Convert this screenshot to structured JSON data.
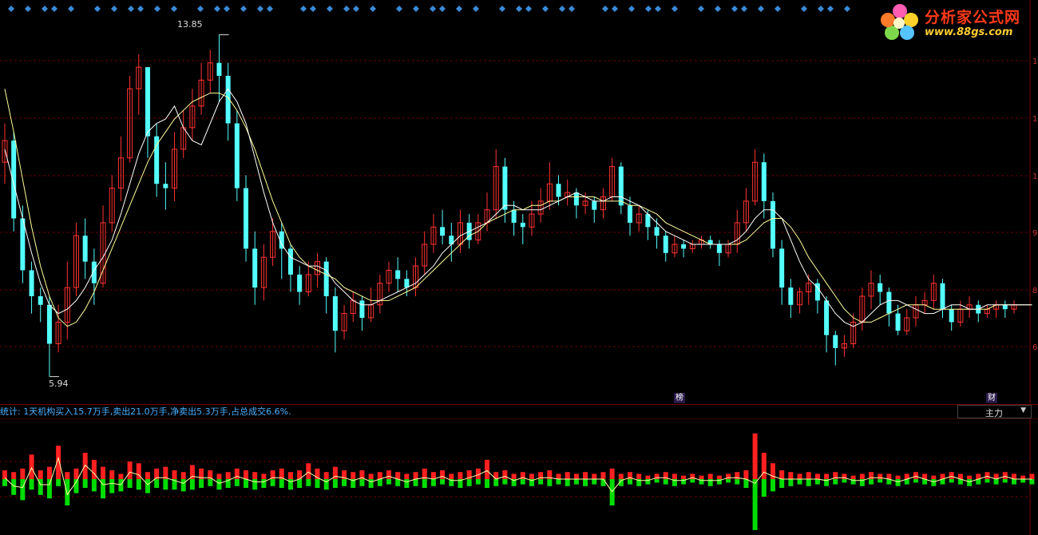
{
  "logo": {
    "title": "分析家公式网",
    "url": "www.88gs.com"
  },
  "stats_text": "统计: 1天机构买入15.7万手,卖出21.0万手,净卖出5.3万手,占总成交6.6%.",
  "dropdown": {
    "selected": "主力",
    "arrow": "▼"
  },
  "badges": {
    "bang": "榜",
    "cai": "财"
  },
  "right_axis_labels": [
    "1",
    "1",
    "1",
    "9",
    "8",
    "6"
  ],
  "colors": {
    "up": "#ff3232",
    "down": "#54ffff",
    "ma_short": "#ffffff",
    "ma_long": "#ffff99",
    "sub_up": "#ff2020",
    "sub_down": "#00dd00",
    "diamond": "#3a8ad8",
    "grid": "#6a0000"
  },
  "chart_data": [
    {
      "type": "candlestick",
      "annotations": {
        "high": "13.85",
        "low": "5.94"
      },
      "candles": [
        [
          10.9,
          11.4,
          11.8,
          10.4
        ],
        [
          11.4,
          9.6,
          11.6,
          9.3
        ],
        [
          9.6,
          8.4,
          9.9,
          8.1
        ],
        [
          8.4,
          7.8,
          8.6,
          7.4
        ],
        [
          7.8,
          7.6,
          8.0,
          7.2
        ],
        [
          7.6,
          6.7,
          7.8,
          5.94
        ],
        [
          6.7,
          7.2,
          7.6,
          6.5
        ],
        [
          7.2,
          8.0,
          8.6,
          6.8
        ],
        [
          8.0,
          9.2,
          9.5,
          7.8
        ],
        [
          9.2,
          8.6,
          9.6,
          8.2
        ],
        [
          8.6,
          8.1,
          8.9,
          7.6
        ],
        [
          8.1,
          9.5,
          9.9,
          8.0
        ],
        [
          9.5,
          10.3,
          10.6,
          9.3
        ],
        [
          10.3,
          11.0,
          11.5,
          10.0
        ],
        [
          11.0,
          12.6,
          12.9,
          10.9
        ],
        [
          12.6,
          13.1,
          13.4,
          12.0
        ],
        [
          13.1,
          11.5,
          12.4,
          11.0
        ],
        [
          11.5,
          10.4,
          11.8,
          10.1
        ],
        [
          10.4,
          10.3,
          10.9,
          9.8
        ],
        [
          10.3,
          11.2,
          11.6,
          10.0
        ],
        [
          11.2,
          11.7,
          12.1,
          11.0
        ],
        [
          11.7,
          12.2,
          12.6,
          11.4
        ],
        [
          12.2,
          12.8,
          13.2,
          12.0
        ],
        [
          12.8,
          13.2,
          13.5,
          12.5
        ],
        [
          13.2,
          12.9,
          13.85,
          12.3
        ],
        [
          12.9,
          11.8,
          13.2,
          11.4
        ],
        [
          11.8,
          10.3,
          12.1,
          10.0
        ],
        [
          10.3,
          8.9,
          10.6,
          8.6
        ],
        [
          8.9,
          8.0,
          9.3,
          7.6
        ],
        [
          8.0,
          8.7,
          9.0,
          7.7
        ],
        [
          8.7,
          9.3,
          9.6,
          8.5
        ],
        [
          9.3,
          8.9,
          9.5,
          8.2
        ],
        [
          8.9,
          8.3,
          9.0,
          7.9
        ],
        [
          8.3,
          7.9,
          8.5,
          7.6
        ],
        [
          7.9,
          8.3,
          8.6,
          7.8
        ],
        [
          8.3,
          8.6,
          8.8,
          8.0
        ],
        [
          8.6,
          7.8,
          8.7,
          7.4
        ],
        [
          7.8,
          7.0,
          8.0,
          6.5
        ],
        [
          7.0,
          7.4,
          7.6,
          6.8
        ],
        [
          7.4,
          7.7,
          7.9,
          7.2
        ],
        [
          7.7,
          7.3,
          7.8,
          7.0
        ],
        [
          7.3,
          7.6,
          8.0,
          7.2
        ],
        [
          7.6,
          8.1,
          8.3,
          7.4
        ],
        [
          8.1,
          8.4,
          8.6,
          7.9
        ],
        [
          8.4,
          8.2,
          8.7,
          7.9
        ],
        [
          8.2,
          8.0,
          8.4,
          7.8
        ],
        [
          8.0,
          8.5,
          8.7,
          7.8
        ],
        [
          8.5,
          9.0,
          9.3,
          8.3
        ],
        [
          9.0,
          9.4,
          9.7,
          8.8
        ],
        [
          9.4,
          9.2,
          9.8,
          9.0
        ],
        [
          9.2,
          9.0,
          9.5,
          8.6
        ],
        [
          9.0,
          9.5,
          9.8,
          8.8
        ],
        [
          9.5,
          9.1,
          9.7,
          8.9
        ],
        [
          9.1,
          9.5,
          9.7,
          9.0
        ],
        [
          9.5,
          9.8,
          10.2,
          9.3
        ],
        [
          9.8,
          10.8,
          11.2,
          9.6
        ],
        [
          10.8,
          9.8,
          11.0,
          9.5
        ],
        [
          9.8,
          9.5,
          10.0,
          9.2
        ],
        [
          9.5,
          9.4,
          9.7,
          9.0
        ],
        [
          9.4,
          9.7,
          10.0,
          9.2
        ],
        [
          9.7,
          10.0,
          10.3,
          9.5
        ],
        [
          10.0,
          10.4,
          10.9,
          9.8
        ],
        [
          10.4,
          10.1,
          10.6,
          9.9
        ],
        [
          10.1,
          10.2,
          10.5,
          9.9
        ],
        [
          10.2,
          9.9,
          10.3,
          9.6
        ],
        [
          9.9,
          10.0,
          10.2,
          9.7
        ],
        [
          10.0,
          9.8,
          10.1,
          9.5
        ],
        [
          9.8,
          10.1,
          10.3,
          9.6
        ],
        [
          10.1,
          10.8,
          11.0,
          10.0
        ],
        [
          10.8,
          9.9,
          10.9,
          9.7
        ],
        [
          9.9,
          9.5,
          10.1,
          9.2
        ],
        [
          9.5,
          9.7,
          9.9,
          9.3
        ],
        [
          9.7,
          9.4,
          9.8,
          9.1
        ],
        [
          9.4,
          9.2,
          9.6,
          8.9
        ],
        [
          9.2,
          8.8,
          9.3,
          8.6
        ],
        [
          8.8,
          9.0,
          9.2,
          8.7
        ],
        [
          9.0,
          8.9,
          9.1,
          8.7
        ],
        [
          8.9,
          9.0,
          9.1,
          8.8
        ],
        [
          9.0,
          9.1,
          9.2,
          8.9
        ],
        [
          9.1,
          9.0,
          9.2,
          8.9
        ],
        [
          9.0,
          8.8,
          9.1,
          8.5
        ],
        [
          8.8,
          9.0,
          9.1,
          8.7
        ],
        [
          9.0,
          9.5,
          9.8,
          8.8
        ],
        [
          9.5,
          10.0,
          10.3,
          9.3
        ],
        [
          10.0,
          10.9,
          11.2,
          9.9
        ],
        [
          10.9,
          10.0,
          11.1,
          9.6
        ],
        [
          10.0,
          8.9,
          10.2,
          8.7
        ],
        [
          8.9,
          8.0,
          9.1,
          7.6
        ],
        [
          8.0,
          7.6,
          8.2,
          7.3
        ],
        [
          7.6,
          7.9,
          8.0,
          7.4
        ],
        [
          7.9,
          8.1,
          8.3,
          7.6
        ],
        [
          8.1,
          7.7,
          8.2,
          7.4
        ],
        [
          7.7,
          6.9,
          7.8,
          6.5
        ],
        [
          6.9,
          6.6,
          7.0,
          6.2
        ],
        [
          6.6,
          6.7,
          6.9,
          6.4
        ],
        [
          6.7,
          7.2,
          7.4,
          6.6
        ],
        [
          7.2,
          7.8,
          8.0,
          7.0
        ],
        [
          7.8,
          8.1,
          8.4,
          7.5
        ],
        [
          8.1,
          7.9,
          8.3,
          7.6
        ],
        [
          7.9,
          7.4,
          8.0,
          7.1
        ],
        [
          7.4,
          7.0,
          7.6,
          6.9
        ],
        [
          7.0,
          7.3,
          7.5,
          6.9
        ],
        [
          7.3,
          7.6,
          7.8,
          7.1
        ],
        [
          7.6,
          7.7,
          7.9,
          7.4
        ],
        [
          7.7,
          8.1,
          8.3,
          7.5
        ],
        [
          8.1,
          7.5,
          8.2,
          7.3
        ],
        [
          7.5,
          7.2,
          7.6,
          7.0
        ],
        [
          7.2,
          7.5,
          7.7,
          7.1
        ],
        [
          7.5,
          7.6,
          7.8,
          7.3
        ],
        [
          7.6,
          7.4,
          7.7,
          7.2
        ],
        [
          7.4,
          7.5,
          7.6,
          7.3
        ],
        [
          7.5,
          7.6,
          7.7,
          7.3
        ],
        [
          7.6,
          7.5,
          7.7,
          7.3
        ],
        [
          7.5,
          7.6,
          7.7,
          7.4
        ]
      ],
      "ma_short": [
        11.2,
        10.4,
        9.6,
        8.8,
        8.1,
        7.6,
        7.4,
        7.5,
        7.7,
        8.0,
        8.4,
        8.7,
        9.1,
        9.7,
        10.4,
        11.1,
        11.6,
        11.8,
        11.9,
        12.2,
        11.7,
        11.4,
        11.3,
        11.8,
        12.3,
        12.6,
        12.3,
        11.8,
        11.0,
        10.2,
        9.5,
        9.0,
        8.7,
        8.6,
        8.5,
        8.5,
        8.4,
        8.1,
        7.9,
        7.7,
        7.6,
        7.6,
        7.7,
        7.8,
        7.9,
        8.0,
        8.1,
        8.3,
        8.5,
        8.8,
        9.0,
        9.2,
        9.3,
        9.4,
        9.5,
        9.7,
        9.9,
        9.9,
        9.8,
        9.8,
        9.8,
        9.9,
        10.0,
        10.1,
        10.2,
        10.1,
        10.0,
        10.0,
        10.1,
        10.1,
        10.0,
        9.9,
        9.7,
        9.5,
        9.3,
        9.2,
        9.1,
        9.0,
        9.0,
        9.0,
        9.0,
        9.0,
        9.1,
        9.3,
        9.6,
        9.8,
        9.8,
        9.6,
        9.1,
        8.6,
        8.2,
        8.0,
        7.7,
        7.4,
        7.2,
        7.1,
        7.2,
        7.4,
        7.6,
        7.7,
        7.7,
        7.6,
        7.5,
        7.4,
        7.4,
        7.5,
        7.6,
        7.6,
        7.5,
        7.5,
        7.6,
        7.6,
        7.6,
        7.6,
        7.6,
        7.6
      ],
      "ma_long": [
        12.6,
        11.6,
        10.5,
        9.4,
        8.5,
        7.8,
        7.3,
        7.1,
        7.2,
        7.5,
        7.9,
        8.4,
        8.9,
        9.4,
        9.9,
        10.4,
        10.9,
        11.3,
        11.6,
        11.9,
        12.1,
        12.3,
        12.4,
        12.5,
        12.5,
        12.4,
        12.1,
        11.7,
        11.2,
        10.6,
        10.0,
        9.5,
        9.0,
        8.7,
        8.5,
        8.4,
        8.3,
        8.2,
        8.0,
        7.9,
        7.8,
        7.7,
        7.7,
        7.7,
        7.8,
        7.9,
        8.0,
        8.2,
        8.4,
        8.6,
        8.8,
        9.0,
        9.2,
        9.3,
        9.5,
        9.6,
        9.7,
        9.8,
        9.8,
        9.9,
        9.9,
        10.0,
        10.0,
        10.1,
        10.1,
        10.1,
        10.1,
        10.0,
        10.0,
        10.0,
        9.9,
        9.9,
        9.8,
        9.7,
        9.5,
        9.4,
        9.3,
        9.2,
        9.1,
        9.0,
        9.0,
        9.0,
        9.0,
        9.1,
        9.3,
        9.5,
        9.6,
        9.6,
        9.4,
        9.1,
        8.7,
        8.4,
        8.1,
        7.8,
        7.5,
        7.3,
        7.2,
        7.2,
        7.3,
        7.4,
        7.5,
        7.6,
        7.6,
        7.6,
        7.5,
        7.5,
        7.5,
        7.5,
        7.5,
        7.5,
        7.5,
        7.6,
        7.6,
        7.6,
        7.6,
        7.6
      ]
    },
    {
      "type": "bar",
      "buy": [
        0.5,
        0.4,
        0.6,
        1.4,
        0.5,
        0.7,
        1.9,
        0.4,
        0.6,
        1.5,
        1.1,
        0.7,
        0.5,
        0.3,
        1.0,
        0.9,
        0.4,
        0.6,
        0.7,
        0.5,
        0.4,
        0.8,
        0.6,
        0.5,
        0.3,
        0.4,
        0.6,
        0.5,
        0.4,
        0.3,
        0.5,
        0.6,
        0.4,
        0.5,
        0.9,
        0.6,
        0.4,
        0.7,
        0.5,
        0.4,
        0.5,
        0.3,
        0.4,
        0.5,
        0.4,
        0.3,
        0.4,
        0.6,
        0.4,
        0.5,
        0.3,
        0.4,
        0.5,
        0.6,
        1.1,
        0.4,
        0.5,
        0.3,
        0.4,
        0.3,
        0.4,
        0.5,
        0.3,
        0.4,
        0.3,
        0.4,
        0.3,
        0.4,
        0.6,
        0.3,
        0.4,
        0.3,
        0.2,
        0.3,
        0.4,
        0.3,
        0.2,
        0.3,
        0.2,
        0.3,
        0.2,
        0.3,
        0.4,
        0.5,
        2.6,
        1.5,
        0.9,
        0.5,
        0.4,
        0.3,
        0.4,
        0.3,
        0.3,
        0.4,
        0.3,
        0.2,
        0.3,
        0.4,
        0.3,
        0.3,
        0.2,
        0.3,
        0.4,
        0.3,
        0.2,
        0.3,
        0.4,
        0.3,
        0.2,
        0.3,
        0.4,
        0.3,
        0.4,
        0.3,
        0.2,
        0.3
      ],
      "sell": [
        0.4,
        0.9,
        1.2,
        0.6,
        0.9,
        1.1,
        0.4,
        1.5,
        0.8,
        0.5,
        0.7,
        1.1,
        0.8,
        0.7,
        0.5,
        0.6,
        0.8,
        0.5,
        0.6,
        0.6,
        0.7,
        0.6,
        0.5,
        0.4,
        0.6,
        0.5,
        0.4,
        0.5,
        0.6,
        0.5,
        0.4,
        0.5,
        0.6,
        0.5,
        0.4,
        0.5,
        0.6,
        0.5,
        0.4,
        0.5,
        0.4,
        0.5,
        0.4,
        0.3,
        0.4,
        0.5,
        0.4,
        0.5,
        0.4,
        0.3,
        0.4,
        0.5,
        0.4,
        0.3,
        0.5,
        0.4,
        0.3,
        0.4,
        0.3,
        0.4,
        0.3,
        0.4,
        0.3,
        0.4,
        0.3,
        0.4,
        0.3,
        0.4,
        1.5,
        0.4,
        0.3,
        0.4,
        0.3,
        0.2,
        0.3,
        0.4,
        0.3,
        0.2,
        0.3,
        0.4,
        0.3,
        0.2,
        0.3,
        0.5,
        2.9,
        1.0,
        0.7,
        0.5,
        0.4,
        0.3,
        0.4,
        0.3,
        0.4,
        0.3,
        0.2,
        0.3,
        0.4,
        0.3,
        0.2,
        0.3,
        0.4,
        0.3,
        0.2,
        0.3,
        0.4,
        0.3,
        0.2,
        0.3,
        0.4,
        0.3,
        0.2,
        0.3,
        0.2,
        0.3,
        0.2,
        0.3
      ]
    }
  ]
}
